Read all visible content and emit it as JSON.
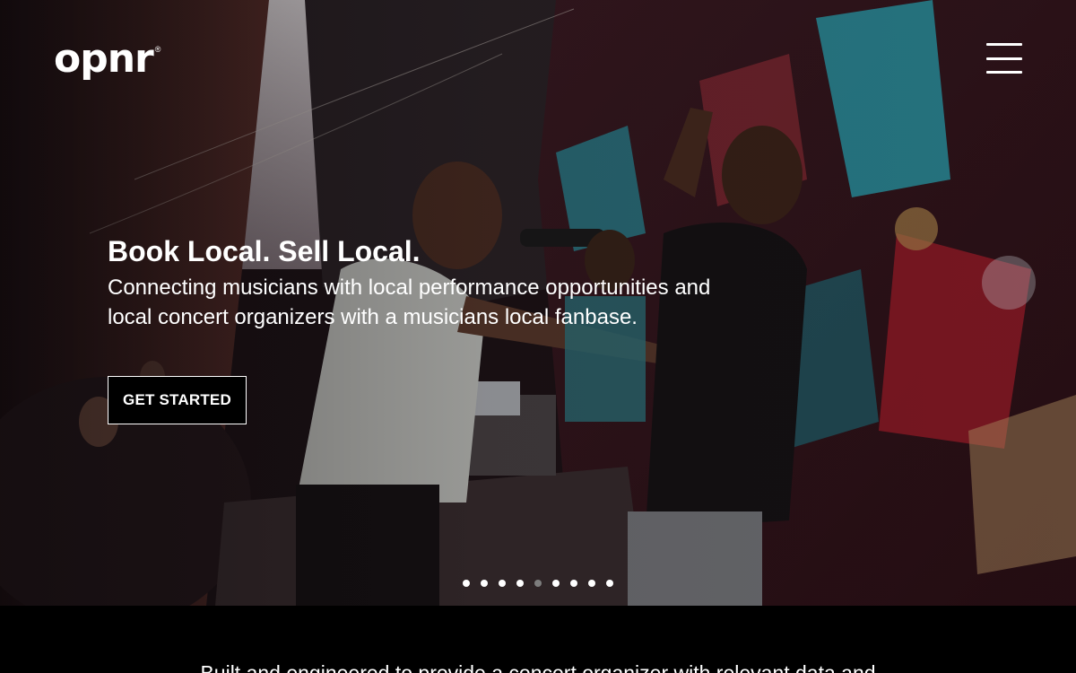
{
  "brand": {
    "logo_text": "opnr",
    "logo_mark": "®"
  },
  "nav": {
    "menu_icon": "hamburger-menu-icon"
  },
  "hero": {
    "title": "Book Local. Sell Local.",
    "subtitle": "Connecting musicians with local performance opportunities and local concert organizers with a musicians local fanbase.",
    "cta_label": "GET STARTED",
    "slide_count": 9,
    "active_slide": 5
  },
  "intro": {
    "text": "Built and engineered to provide a concert organizer with relevant data and"
  },
  "colors": {
    "background": "#000000",
    "text": "#ffffff",
    "dot_active": "#ffffff",
    "dot_inactive": "#7d7d7d"
  }
}
